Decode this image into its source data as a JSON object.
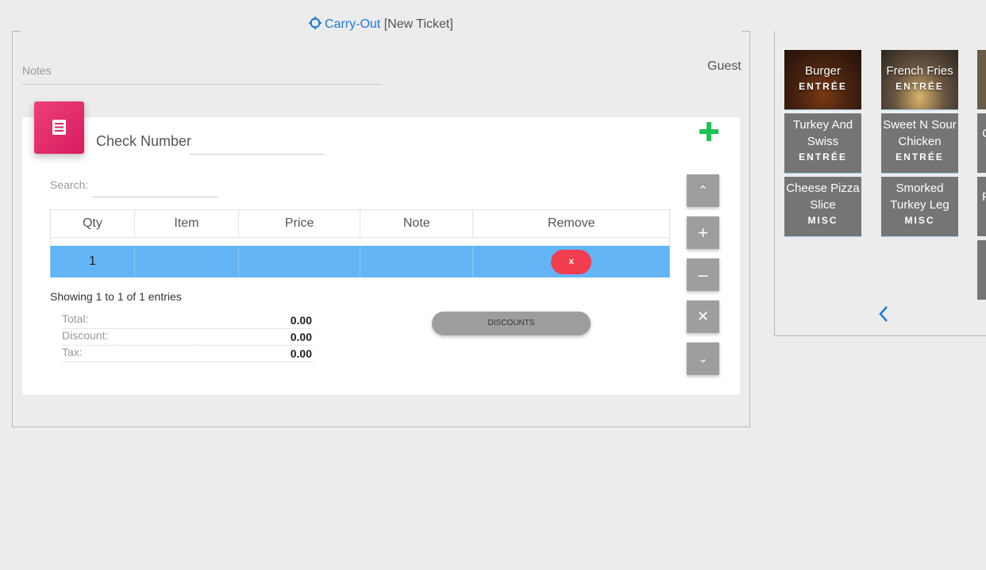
{
  "header": {
    "order_type": "Carry-Out",
    "ticket_status": "[New Ticket]"
  },
  "order": {
    "notes_label": "Notes",
    "guest_label": "Guest",
    "check_number_label": "Check Number",
    "check_number_value": "",
    "search_label": "Search:",
    "search_value": "",
    "table": {
      "columns": [
        "Qty",
        "Item",
        "Price",
        "Note",
        "Remove"
      ],
      "rows": [
        {
          "qty": "1",
          "item": "",
          "price": "",
          "note": "",
          "remove_label": "x"
        }
      ]
    },
    "entries_info": "Showing 1 to 1 of 1 entries",
    "totals": [
      {
        "label": "Total:",
        "value": "0.00"
      },
      {
        "label": "Discount:",
        "value": "0.00"
      },
      {
        "label": "Tax:",
        "value": "0.00"
      }
    ],
    "discounts_button": "DISCOUNTS",
    "side_buttons": [
      "⌃",
      "+",
      "–",
      "✕",
      "⌄"
    ]
  },
  "menu": {
    "items": [
      {
        "name": "Burger",
        "category": "ENTRÉE"
      },
      {
        "name": "French Fries",
        "category": "ENTRÉE"
      },
      {
        "name": "Turkey And Swiss",
        "category": "ENTRÉE"
      },
      {
        "name": "Sweet N Sour Chicken",
        "category": "ENTRÉE"
      },
      {
        "name": "Cheese Pizza Slice",
        "category": "MISC"
      },
      {
        "name": "Smorked Turkey Leg",
        "category": "MISC"
      }
    ],
    "partial_tile_letters": [
      "C",
      "F"
    ]
  },
  "colors": {
    "accent_blue": "#1e7bd8",
    "add_green": "#1bc453",
    "selected_row": "#64b5f6",
    "remove_red": "#f23d4f",
    "icon_pink": "#e91e63",
    "tile_gray": "#757575",
    "button_gray": "#9e9e9e"
  },
  "icons": {
    "order_type": "crosshair-icon",
    "card": "receipt-icon",
    "add": "plus-icon",
    "pager": "chevron-left-icon"
  }
}
